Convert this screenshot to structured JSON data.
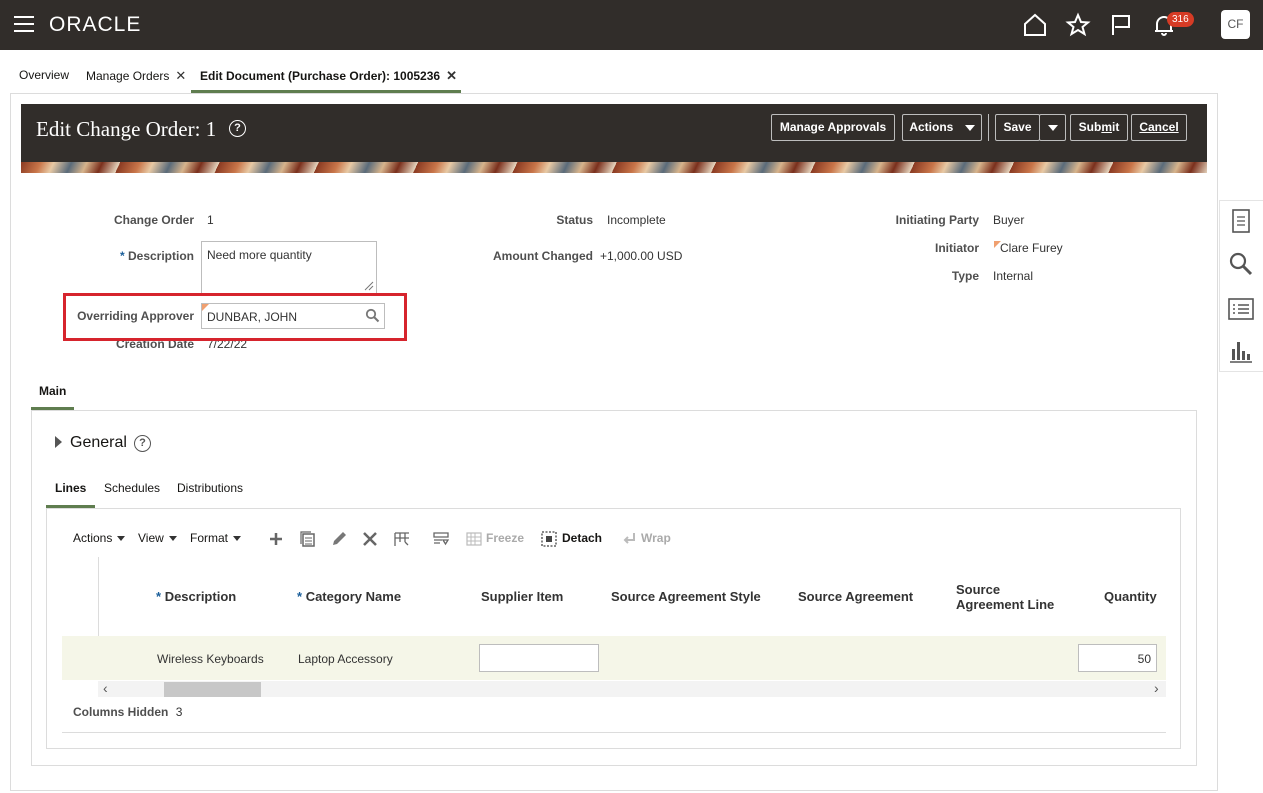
{
  "app": {
    "logo": "ORACLE",
    "notification_count": "316",
    "user_initials": "CF"
  },
  "tabs": [
    {
      "label": "Overview"
    },
    {
      "label": "Manage Orders"
    },
    {
      "label": "Edit Document (Purchase Order): 1005236"
    }
  ],
  "header": {
    "title": "Edit Change Order: 1",
    "help": "?",
    "buttons": {
      "manage_approvals": "Manage Approvals",
      "actions": "Actions",
      "save": "Save",
      "submit_pre": "Sub",
      "submit_u": "m",
      "submit_post": "it",
      "cancel_u": "C",
      "cancel_post": "ancel"
    }
  },
  "form": {
    "change_order_label": "Change Order",
    "change_order_value": "1",
    "description_label": "Description",
    "description_value": "Need more quantity",
    "approver_label": "Overriding Approver",
    "approver_value": "DUNBAR, JOHN",
    "creation_date_label": "Creation Date",
    "creation_date_value": "7/22/22",
    "status_label": "Status",
    "status_value": "Incomplete",
    "amount_label": "Amount Changed",
    "amount_value": "+1,000.00 USD",
    "initiating_party_label": "Initiating Party",
    "initiating_party_value": "Buyer",
    "initiator_label": "Initiator",
    "initiator_value": "Clare Furey",
    "type_label": "Type",
    "type_value": "Internal"
  },
  "main_tab": "Main",
  "general": {
    "title": "General",
    "help": "?"
  },
  "subtabs": [
    "Lines",
    "Schedules",
    "Distributions"
  ],
  "toolbar": {
    "actions": "Actions",
    "view": "View",
    "format": "Format",
    "freeze": "Freeze",
    "detach": "Detach",
    "wrap": "Wrap"
  },
  "table": {
    "required_marker": "*",
    "columns": {
      "description": "Description",
      "category": "Category Name",
      "supplier_item": "Supplier Item",
      "agreement_style": "Source Agreement Style",
      "agreement": "Source Agreement",
      "agreement_line_1": "Source",
      "agreement_line_2": "Agreement Line",
      "quantity": "Quantity"
    },
    "rows": [
      {
        "description": "Wireless Keyboards",
        "category": "Laptop Accessory",
        "supplier_item": "",
        "quantity": "50"
      }
    ],
    "columns_hidden_label": "Columns Hidden",
    "columns_hidden_value": "3"
  },
  "colors": {
    "topbar": "#312d2a",
    "accent_green": "#5f7d4f",
    "highlight_red": "#d6242d",
    "row_highlight": "#f5f6e8"
  }
}
